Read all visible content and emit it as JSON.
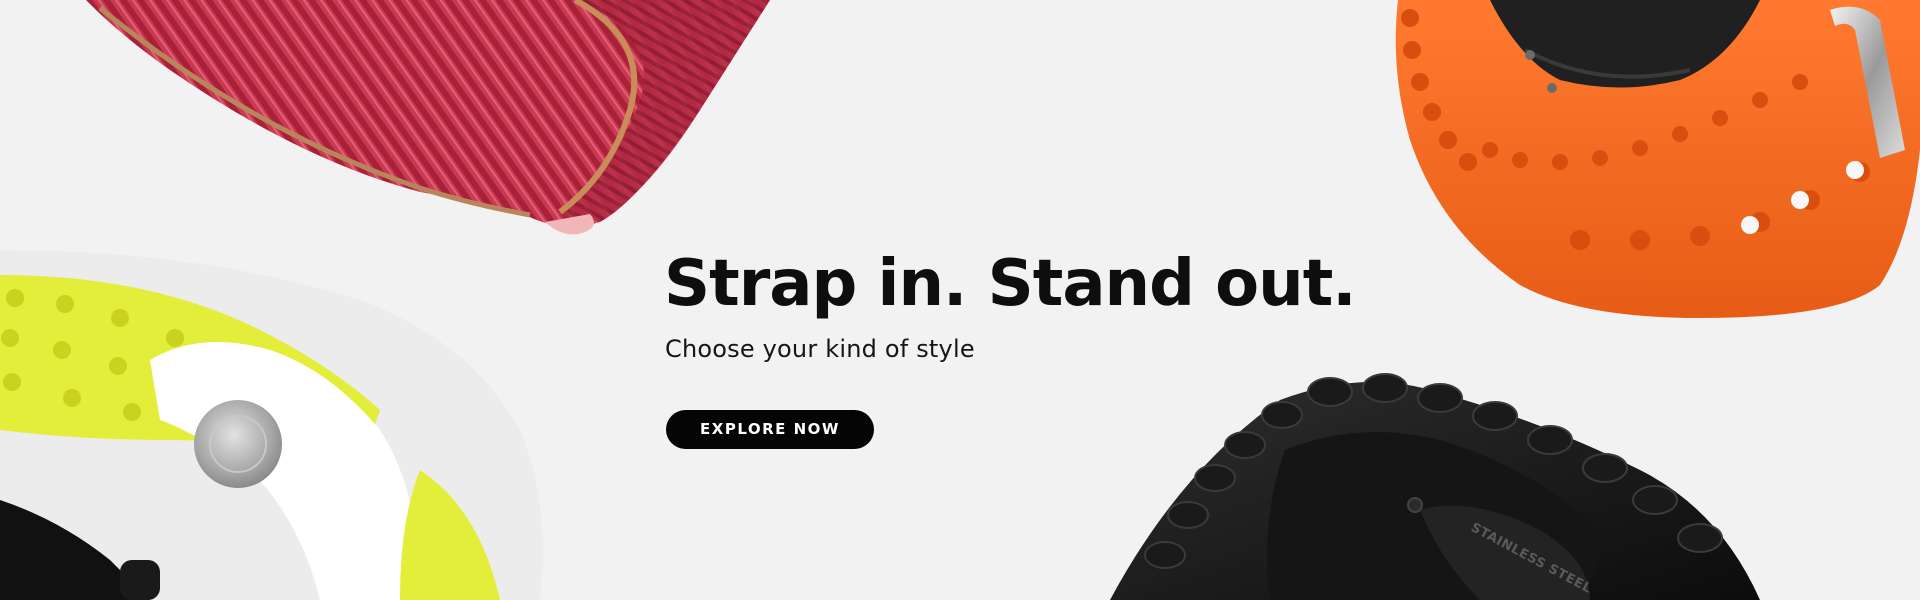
{
  "banner": {
    "headline": "Strap in. Stand out.",
    "subheadline": "Choose your kind of style",
    "cta_label": "EXPLORE NOW",
    "background_color": "#f2f2f2",
    "button_color": "#050505"
  },
  "products": [
    {
      "name": "red-nylon-loop-strap",
      "color": "#c9374f"
    },
    {
      "name": "orange-ocean-silicone-strap",
      "color": "#f26a22"
    },
    {
      "name": "white-yellow-sport-strap",
      "color": "#e8f046"
    },
    {
      "name": "black-link-bracelet",
      "color": "#141414",
      "engraving": "STAINLESS STEEL"
    }
  ]
}
